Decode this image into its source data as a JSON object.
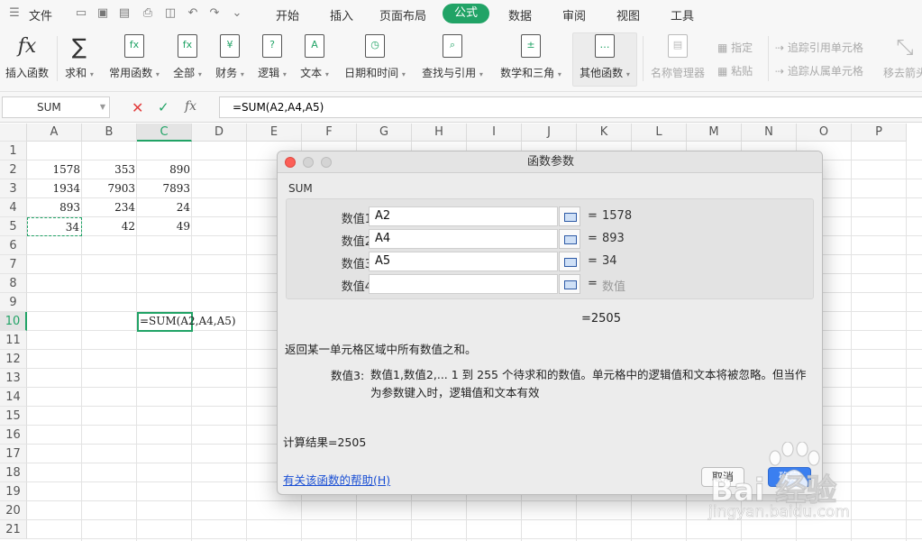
{
  "menubar": {
    "file": "文件",
    "tabs": [
      "开始",
      "插入",
      "页面布局",
      "公式",
      "数据",
      "审阅",
      "视图",
      "工具"
    ],
    "active_tab": "公式"
  },
  "ribbon": {
    "insert_function": "插入函数",
    "sum": "求和",
    "common": "常用函数",
    "all": "全部",
    "finance": "财务",
    "logic": "逻辑",
    "text": "文本",
    "datetime": "日期和时间",
    "lookup": "查找与引用",
    "math": "数学和三角",
    "other": "其他函数",
    "name_manager": "名称管理器",
    "assign": "指定",
    "paste": "粘贴",
    "trace_precedents": "追踪引用单元格",
    "trace_dependents": "追踪从属单元格",
    "remove_arrows": "移去箭头"
  },
  "formula_bar": {
    "name_box": "SUM",
    "formula": "=SUM(A2,A4,A5)",
    "fx_label": "fx"
  },
  "sheet": {
    "columns": [
      "A",
      "B",
      "C",
      "D",
      "E",
      "F",
      "G",
      "H",
      "I",
      "J",
      "K",
      "L",
      "M",
      "N",
      "O",
      "P"
    ],
    "active_column": "C",
    "active_row": "10",
    "rows": [
      "1",
      "2",
      "3",
      "4",
      "5",
      "6",
      "7",
      "8",
      "9",
      "10",
      "11",
      "12",
      "13",
      "14",
      "15",
      "16",
      "17",
      "18",
      "19",
      "20",
      "21"
    ],
    "cells": [
      {
        "ref": "A2",
        "value": "1578"
      },
      {
        "ref": "B2",
        "value": "353"
      },
      {
        "ref": "C2",
        "value": "890"
      },
      {
        "ref": "A3",
        "value": "1934"
      },
      {
        "ref": "B3",
        "value": "7903"
      },
      {
        "ref": "C3",
        "value": "7893"
      },
      {
        "ref": "A4",
        "value": "893"
      },
      {
        "ref": "B4",
        "value": "234"
      },
      {
        "ref": "C4",
        "value": "24"
      },
      {
        "ref": "A5",
        "value": "34"
      },
      {
        "ref": "B5",
        "value": "42"
      },
      {
        "ref": "C5",
        "value": "49"
      }
    ],
    "c10": "=SUM(A2,A4,A5)"
  },
  "dialog": {
    "title": "函数参数",
    "function_name": "SUM",
    "args": [
      {
        "label": "数值1",
        "value": "A2",
        "result": "1578",
        "placeholder": false
      },
      {
        "label": "数值2",
        "value": "A4",
        "result": "893",
        "placeholder": false
      },
      {
        "label": "数值3",
        "value": "A5",
        "result": "34",
        "placeholder": false
      },
      {
        "label": "数值4",
        "value": "",
        "result": "数值",
        "placeholder": true
      }
    ],
    "eq": "=",
    "formula_result": "=2505",
    "description": "返回某一单元格区域中所有数值之和。",
    "param_label": "数值3:",
    "param_desc": "数值1,数值2,... 1 到 255 个待求和的数值。单元格中的逻辑值和文本将被忽略。但当作为参数键入时，逻辑值和文本有效",
    "calc_result": "计算结果=2505",
    "help_link": "有关该函数的帮助(H)",
    "cancel": "取消",
    "ok": "确定"
  },
  "watermark": {
    "brand": "Bai 经验",
    "url": "jingyan.baidu.com"
  },
  "colors": {
    "accent": "#21a366",
    "close_red": "#fc5f57",
    "link": "#1a4fd4"
  }
}
